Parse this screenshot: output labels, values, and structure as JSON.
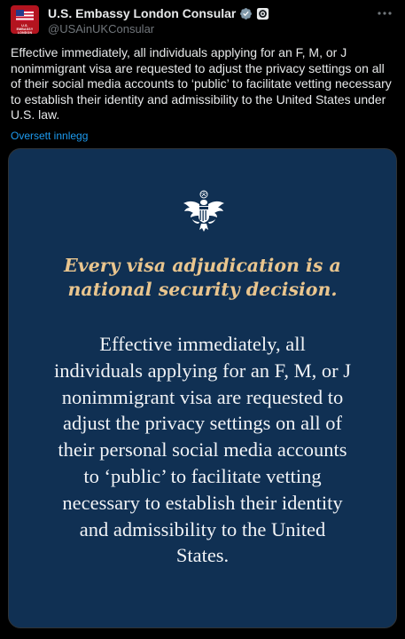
{
  "account": {
    "display_name": "U.S. Embassy London Consular",
    "handle": "@USAinUKConsular",
    "avatar_text": "U.S. EMBASSY LONDON",
    "verified_badge_color": "#829aab"
  },
  "tweet": {
    "text": "Effective immediately, all individuals applying for an F, M, or J nonimmigrant visa are requested to adjust the privacy settings on all of their social media accounts to ‘public’ to facilitate vetting necessary to establish their identity and admissibility to the United States under U.S. law.",
    "translate_label": "Oversett innlegg"
  },
  "card": {
    "background": "#103053",
    "headline_line1": "Every visa adjudication is a",
    "headline_line2": "national security decision.",
    "body_text": "Effective immediately, all individuals applying for an F, M, or J nonimmigrant visa are requested to adjust the privacy settings on all of their personal social media accounts to ‘public’ to facilitate vetting necessary to establish their identity and admissibility to the United States."
  },
  "icons": {
    "badge": "verified-badge-icon",
    "affiliate": "affiliate-seal-icon",
    "more": "more-icon",
    "seal": "eagle-seal-icon"
  }
}
